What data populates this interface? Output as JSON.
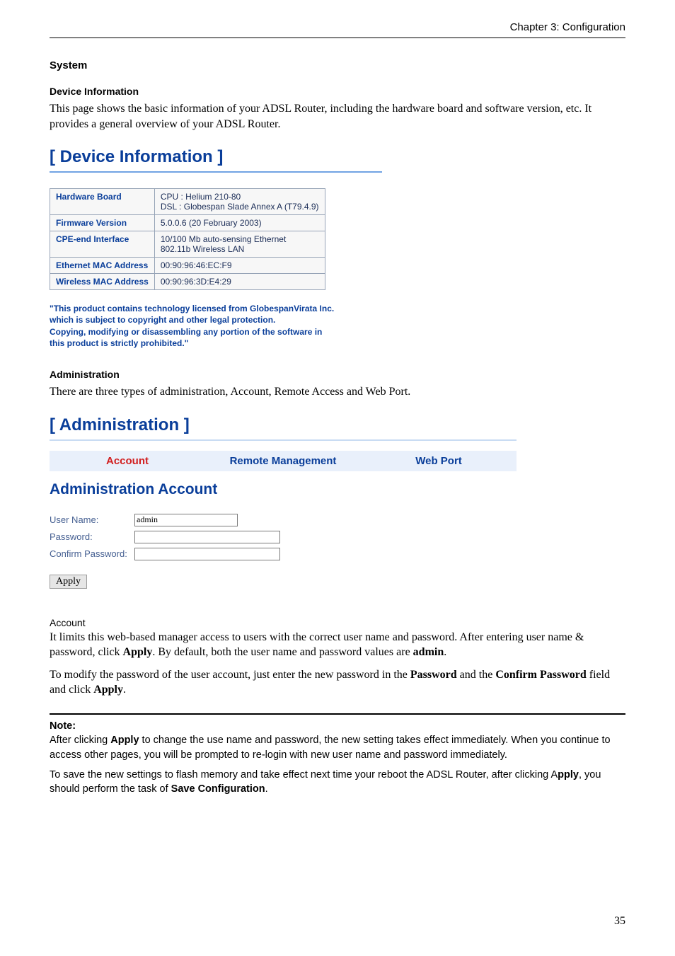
{
  "header": {
    "chapter": "Chapter 3: Configuration"
  },
  "sections": {
    "system_heading": "System",
    "device_info_heading": "Device Information",
    "device_info_text": "This page shows the basic information of your ADSL Router, including the hardware board and software version, etc. It provides a general overview of your ADSL Router.",
    "admin_heading": "Administration",
    "admin_text": "There are three types of administration, Account, Remote Access and Web Port."
  },
  "device_panel": {
    "title": "[ Device Information ]",
    "rows": {
      "hardware_board_label": "Hardware Board",
      "hardware_board_value1": "CPU : Helium 210-80",
      "hardware_board_value2": "DSL : Globespan Slade Annex A (T79.4.9)",
      "firmware_label": "Firmware Version",
      "firmware_value": "5.0.0.6 (20 February 2003)",
      "cpe_label": "CPE-end Interface",
      "cpe_value1": "10/100 Mb auto-sensing Ethernet",
      "cpe_value2": "802.11b Wireless LAN",
      "eth_mac_label": "Ethernet MAC Address",
      "eth_mac_value": "00:90:96:46:EC:F9",
      "wl_mac_label": "Wireless MAC Address",
      "wl_mac_value": "00:90:96:3D:E4:29"
    },
    "legal1": "\"This product contains technology licensed from GlobespanVirata Inc.",
    "legal2": "which is subject to copyright and other legal protection.",
    "legal3": "Copying, modifying or disassembling any portion of the software in",
    "legal4": "this product is strictly prohibited.\""
  },
  "admin_panel": {
    "title": "[ Administration ]",
    "tabs": {
      "account": "Account",
      "remote": "Remote Management",
      "webport": "Web Port"
    },
    "subtitle": "Administration Account",
    "form": {
      "user_label": "User Name:",
      "user_value": "admin",
      "password_label": "Password:",
      "confirm_label": "Confirm Password:",
      "apply_label": "Apply"
    }
  },
  "account_section": {
    "heading": "Account",
    "p1a": "It limits this web-based manager access to users with the correct user name and password. After entering user name & password, click ",
    "p1b_bold": "Apply",
    "p1c": ". By default, both the user name and password values are ",
    "p1d_bold": "admin",
    "p1e": ".",
    "p2a": "To modify the password of the user account, just enter the new password in the ",
    "p2b_bold": "Password",
    "p2c": " and the ",
    "p2d_bold": "Confirm Password",
    "p2e": " field and click ",
    "p2f_bold": "Apply",
    "p2g": "."
  },
  "note_section": {
    "note_label": "Note:",
    "n1a": "After clicking ",
    "n1b_bold": "Apply",
    "n1c": " to change the use name and password, the new setting takes effect immediately. When you continue to access other pages, you will be prompted to re-login with new user name and password immediately.",
    "n2a": "To save the new settings to flash memory and take effect next time your reboot the ADSL Router, after clicking A",
    "n2b_bold": "pply",
    "n2c": ", you should perform the task of ",
    "n2d_bold": "Save Configuration",
    "n2e": "."
  },
  "page_number": "35"
}
